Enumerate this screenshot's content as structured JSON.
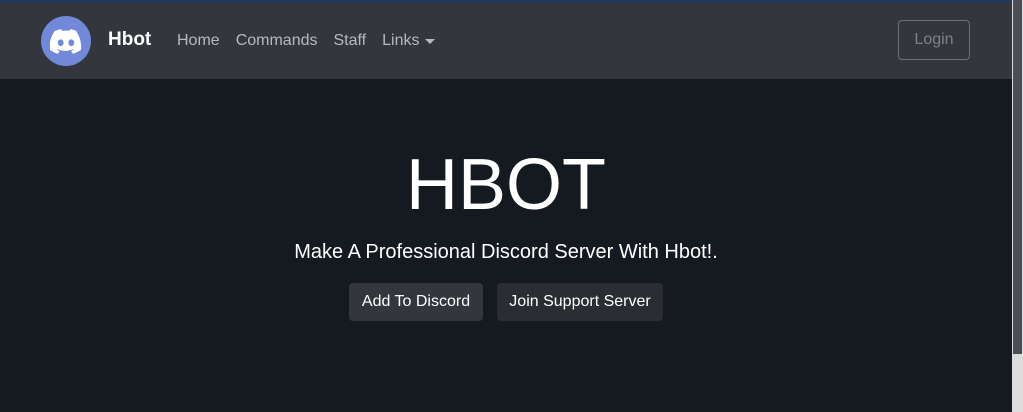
{
  "navbar": {
    "brand": "Hbot",
    "links": [
      {
        "label": "Home"
      },
      {
        "label": "Commands"
      },
      {
        "label": "Staff"
      },
      {
        "label": "Links"
      }
    ],
    "login_label": "Login",
    "avatar_icon": "discord-logo-icon"
  },
  "hero": {
    "title": "HBOT",
    "subtitle": "Make A Professional Discord Server With Hbot!.",
    "buttons": {
      "add": "Add To Discord",
      "join": "Join Support Server"
    }
  },
  "colors": {
    "background": "#151a21",
    "navbar": "#33373d",
    "discord_blurple": "#7289da",
    "button_bg": "#33373d"
  }
}
